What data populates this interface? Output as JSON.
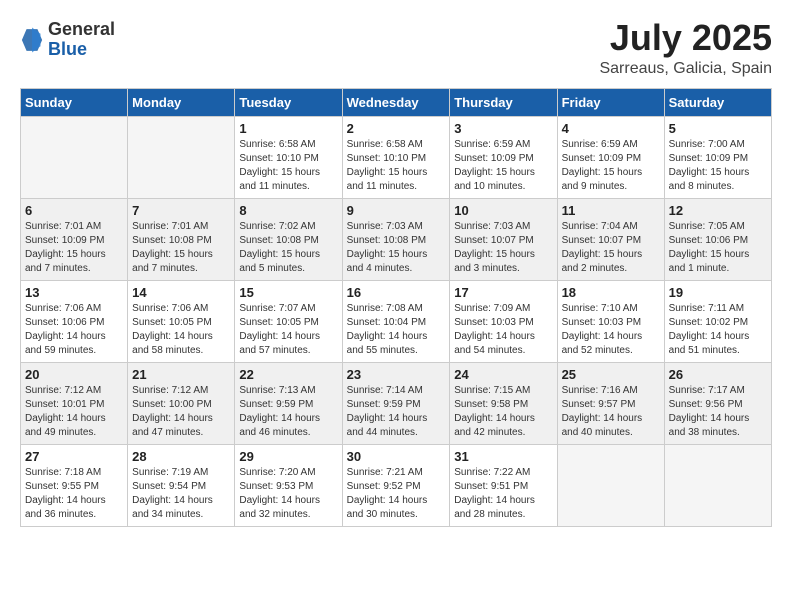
{
  "header": {
    "logo": {
      "general": "General",
      "blue": "Blue"
    },
    "title": "July 2025",
    "location": "Sarreaus, Galicia, Spain"
  },
  "calendar": {
    "weekdays": [
      "Sunday",
      "Monday",
      "Tuesday",
      "Wednesday",
      "Thursday",
      "Friday",
      "Saturday"
    ],
    "weeks": [
      [
        {
          "day": "",
          "empty": true
        },
        {
          "day": "",
          "empty": true
        },
        {
          "day": "1",
          "sunrise": "6:58 AM",
          "sunset": "10:10 PM",
          "daylight": "15 hours and 11 minutes."
        },
        {
          "day": "2",
          "sunrise": "6:58 AM",
          "sunset": "10:10 PM",
          "daylight": "15 hours and 11 minutes."
        },
        {
          "day": "3",
          "sunrise": "6:59 AM",
          "sunset": "10:09 PM",
          "daylight": "15 hours and 10 minutes."
        },
        {
          "day": "4",
          "sunrise": "6:59 AM",
          "sunset": "10:09 PM",
          "daylight": "15 hours and 9 minutes."
        },
        {
          "day": "5",
          "sunrise": "7:00 AM",
          "sunset": "10:09 PM",
          "daylight": "15 hours and 8 minutes."
        }
      ],
      [
        {
          "day": "6",
          "sunrise": "7:01 AM",
          "sunset": "10:09 PM",
          "daylight": "15 hours and 7 minutes."
        },
        {
          "day": "7",
          "sunrise": "7:01 AM",
          "sunset": "10:08 PM",
          "daylight": "15 hours and 7 minutes."
        },
        {
          "day": "8",
          "sunrise": "7:02 AM",
          "sunset": "10:08 PM",
          "daylight": "15 hours and 5 minutes."
        },
        {
          "day": "9",
          "sunrise": "7:03 AM",
          "sunset": "10:08 PM",
          "daylight": "15 hours and 4 minutes."
        },
        {
          "day": "10",
          "sunrise": "7:03 AM",
          "sunset": "10:07 PM",
          "daylight": "15 hours and 3 minutes."
        },
        {
          "day": "11",
          "sunrise": "7:04 AM",
          "sunset": "10:07 PM",
          "daylight": "15 hours and 2 minutes."
        },
        {
          "day": "12",
          "sunrise": "7:05 AM",
          "sunset": "10:06 PM",
          "daylight": "15 hours and 1 minute."
        }
      ],
      [
        {
          "day": "13",
          "sunrise": "7:06 AM",
          "sunset": "10:06 PM",
          "daylight": "14 hours and 59 minutes."
        },
        {
          "day": "14",
          "sunrise": "7:06 AM",
          "sunset": "10:05 PM",
          "daylight": "14 hours and 58 minutes."
        },
        {
          "day": "15",
          "sunrise": "7:07 AM",
          "sunset": "10:05 PM",
          "daylight": "14 hours and 57 minutes."
        },
        {
          "day": "16",
          "sunrise": "7:08 AM",
          "sunset": "10:04 PM",
          "daylight": "14 hours and 55 minutes."
        },
        {
          "day": "17",
          "sunrise": "7:09 AM",
          "sunset": "10:03 PM",
          "daylight": "14 hours and 54 minutes."
        },
        {
          "day": "18",
          "sunrise": "7:10 AM",
          "sunset": "10:03 PM",
          "daylight": "14 hours and 52 minutes."
        },
        {
          "day": "19",
          "sunrise": "7:11 AM",
          "sunset": "10:02 PM",
          "daylight": "14 hours and 51 minutes."
        }
      ],
      [
        {
          "day": "20",
          "sunrise": "7:12 AM",
          "sunset": "10:01 PM",
          "daylight": "14 hours and 49 minutes."
        },
        {
          "day": "21",
          "sunrise": "7:12 AM",
          "sunset": "10:00 PM",
          "daylight": "14 hours and 47 minutes."
        },
        {
          "day": "22",
          "sunrise": "7:13 AM",
          "sunset": "9:59 PM",
          "daylight": "14 hours and 46 minutes."
        },
        {
          "day": "23",
          "sunrise": "7:14 AM",
          "sunset": "9:59 PM",
          "daylight": "14 hours and 44 minutes."
        },
        {
          "day": "24",
          "sunrise": "7:15 AM",
          "sunset": "9:58 PM",
          "daylight": "14 hours and 42 minutes."
        },
        {
          "day": "25",
          "sunrise": "7:16 AM",
          "sunset": "9:57 PM",
          "daylight": "14 hours and 40 minutes."
        },
        {
          "day": "26",
          "sunrise": "7:17 AM",
          "sunset": "9:56 PM",
          "daylight": "14 hours and 38 minutes."
        }
      ],
      [
        {
          "day": "27",
          "sunrise": "7:18 AM",
          "sunset": "9:55 PM",
          "daylight": "14 hours and 36 minutes."
        },
        {
          "day": "28",
          "sunrise": "7:19 AM",
          "sunset": "9:54 PM",
          "daylight": "14 hours and 34 minutes."
        },
        {
          "day": "29",
          "sunrise": "7:20 AM",
          "sunset": "9:53 PM",
          "daylight": "14 hours and 32 minutes."
        },
        {
          "day": "30",
          "sunrise": "7:21 AM",
          "sunset": "9:52 PM",
          "daylight": "14 hours and 30 minutes."
        },
        {
          "day": "31",
          "sunrise": "7:22 AM",
          "sunset": "9:51 PM",
          "daylight": "14 hours and 28 minutes."
        },
        {
          "day": "",
          "empty": true
        },
        {
          "day": "",
          "empty": true
        }
      ]
    ]
  }
}
